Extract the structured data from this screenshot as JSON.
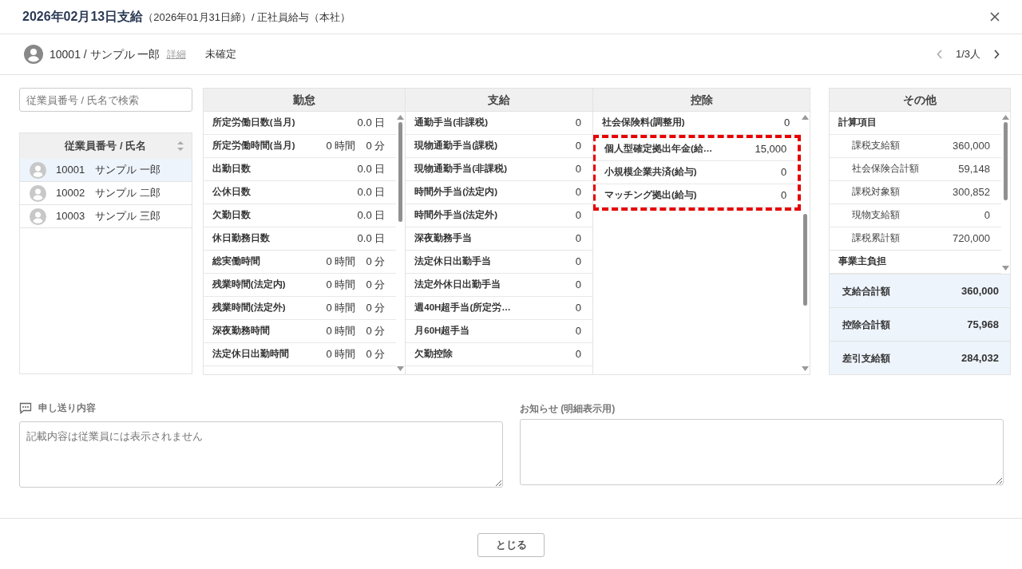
{
  "dialog": {
    "title": "2026年02月13日支給",
    "subtitle": "（2026年01月31日締）/ 正社員給与（本社）"
  },
  "employee_bar": {
    "employee": "10001 / サンプル 一郎",
    "detail_link": "詳細",
    "status": "未確定",
    "pager": "1/3人"
  },
  "search": {
    "placeholder": "従業員番号 / 氏名で検索"
  },
  "employee_list": {
    "header": "従業員番号 / 氏名",
    "items": [
      {
        "number": "10001",
        "name": "サンプル 一郎",
        "selected": true
      },
      {
        "number": "10002",
        "name": "サンプル 二郎",
        "selected": false
      },
      {
        "number": "10003",
        "name": "サンプル 三郎",
        "selected": false
      }
    ]
  },
  "panels": [
    {
      "title": "勤怠",
      "rows": [
        {
          "label": "所定労働日数(当月)",
          "value": "0.0 日"
        },
        {
          "label": "所定労働時間(当月)",
          "value": "0 時間　0 分"
        },
        {
          "label": "出勤日数",
          "value": "0.0 日"
        },
        {
          "label": "公休日数",
          "value": "0.0 日"
        },
        {
          "label": "欠勤日数",
          "value": "0.0 日"
        },
        {
          "label": "休日勤務日数",
          "value": "0.0 日"
        },
        {
          "label": "総実働時間",
          "value": "0 時間　0 分"
        },
        {
          "label": "残業時間(法定内)",
          "value": "0 時間　0 分"
        },
        {
          "label": "残業時間(法定外)",
          "value": "0 時間　0 分"
        },
        {
          "label": "深夜勤務時間",
          "value": "0 時間　0 分"
        },
        {
          "label": "法定休日出勤時間",
          "value": "0 時間　0 分"
        }
      ]
    },
    {
      "title": "支給",
      "rows": [
        {
          "label": "通勤手当(非課税)",
          "value": "0"
        },
        {
          "label": "現物通勤手当(課税)",
          "value": "0"
        },
        {
          "label": "現物通勤手当(非課税)",
          "value": "0"
        },
        {
          "label": "時間外手当(法定内)",
          "value": "0"
        },
        {
          "label": "時間外手当(法定外)",
          "value": "0"
        },
        {
          "label": "深夜勤務手当",
          "value": "0"
        },
        {
          "label": "法定休日出勤手当",
          "value": "0"
        },
        {
          "label": "法定外休日出勤手当",
          "value": "0"
        },
        {
          "label": "週40H超手当(所定労…",
          "value": "0"
        },
        {
          "label": "月60H超手当",
          "value": "0"
        },
        {
          "label": "欠勤控除",
          "value": "0"
        }
      ]
    },
    {
      "title": "控除",
      "rows": [
        {
          "label": "社会保険料(調整用)",
          "value": "0",
          "highlighted": false
        },
        {
          "label": "個人型確定拠出年金(給…",
          "value": "15,000",
          "highlighted": true
        },
        {
          "label": "小規模企業共済(給与)",
          "value": "0",
          "highlighted": true
        },
        {
          "label": "マッチング拠出(給与)",
          "value": "0",
          "highlighted": true
        }
      ]
    }
  ],
  "other": {
    "title": "その他",
    "rows": [
      {
        "kind": "section",
        "label": "計算項目"
      },
      {
        "kind": "item",
        "label": "課税支給額",
        "value": "360,000"
      },
      {
        "kind": "item",
        "label": "社会保険合計額",
        "value": "59,148"
      },
      {
        "kind": "item",
        "label": "課税対象額",
        "value": "300,852"
      },
      {
        "kind": "item",
        "label": "現物支給額",
        "value": "0"
      },
      {
        "kind": "item",
        "label": "課税累計額",
        "value": "720,000"
      },
      {
        "kind": "section",
        "label": "事業主負担"
      }
    ],
    "totals": [
      {
        "label": "支給合計額",
        "value": "360,000"
      },
      {
        "label": "控除合計額",
        "value": "75,968"
      },
      {
        "label": "差引支給額",
        "value": "284,032"
      }
    ]
  },
  "memo": {
    "label": "申し送り内容",
    "placeholder": "記載内容は従業員には表示されません"
  },
  "notice": {
    "label": "お知らせ (明細表示用)"
  },
  "close_button": "とじる"
}
